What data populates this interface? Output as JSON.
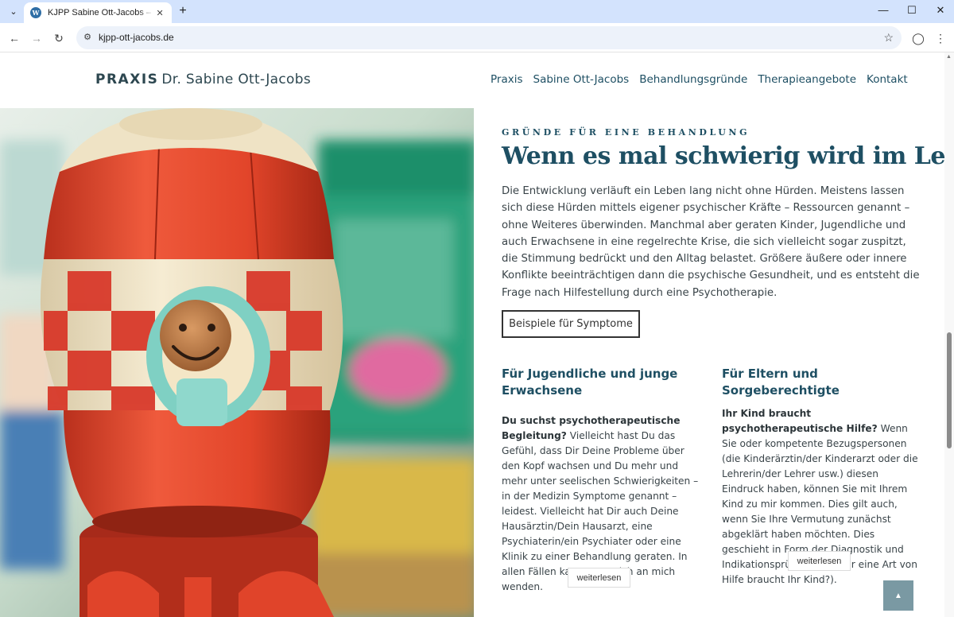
{
  "browser": {
    "tab_title": "KJPP Sabine Ott-Jacobs – Praxis",
    "favicon_letter": "W",
    "url": "kjpp-ott-jacobs.de"
  },
  "header": {
    "logo_bold": "PRAXIS",
    "logo_name": "Dr. Sabine Ott-Jacobs",
    "nav": [
      "Praxis",
      "Sabine Ott-Jacobs",
      "Behandlungsgründe",
      "Therapieangebote",
      "Kontakt"
    ]
  },
  "main": {
    "kicker": "GRÜNDE FÜR EINE BEHANDLUNG",
    "headline": "Wenn es mal schwierig wird im Leben",
    "intro": "Die Entwicklung verläuft ein Leben lang nicht ohne Hürden. Meistens lassen sich diese Hürden mittels eigener psychischer Kräfte – Ressourcen genannt – ohne Weiteres überwinden. Manchmal aber geraten Kinder, Jugendliche und auch Erwachsene in eine regelrechte Krise, die sich vielleicht sogar zuspitzt, die Stimmung bedrückt und den Alltag belastet. Größere äußere oder innere Konflikte beeinträchtigen dann die psychische Gesundheit, und es entsteht die Frage nach Hilfestellung durch eine Psychotherapie.",
    "symptom_button": "Beispiele für Symptome",
    "col_left": {
      "heading": "Für Jugendliche und junge Erwachsene",
      "lead": "Du suchst psychotherapeutische Begleitung?",
      "text": " Vielleicht hast Du das Gefühl, dass Dir Deine Probleme über den Kopf wachsen und Du mehr und mehr unter seelischen Schwierigkeiten – in der Medizin Symptome genannt – leidest. Vielleicht hat Dir auch Deine Hausärztin/Dein Hausarzt, eine Psychiaterin/ein Psychiater oder eine Klinik zu einer Behandlung geraten. In allen Fällen kannst Du Dich an mich wenden.",
      "more": "weiterlesen"
    },
    "col_right": {
      "heading": "Für Eltern und Sorgeberechtigte",
      "lead": "Ihr Kind braucht psychotherapeutische Hilfe?",
      "text": " Wenn Sie oder kompetente Bezugspersonen (die Kinderärztin/der Kinderarzt oder die Lehrerin/der Lehrer usw.) diesen Eindruck haben, können Sie mit Ihrem Kind zu mir kommen. Dies gilt auch, wenn Sie Ihre Vermutung zunächst abgeklärt haben möchten. Dies geschieht in Form der Diagnostik und Indikationsprüfung (was für eine Art von Hilfe braucht Ihr Kind?).",
      "more": "weiterlesen"
    }
  },
  "icons": {
    "to_top": "chevron-up-icon"
  },
  "colors": {
    "accent": "#1e4f63",
    "tabbar": "#d3e3fd",
    "to_top": "#7a99a3"
  }
}
